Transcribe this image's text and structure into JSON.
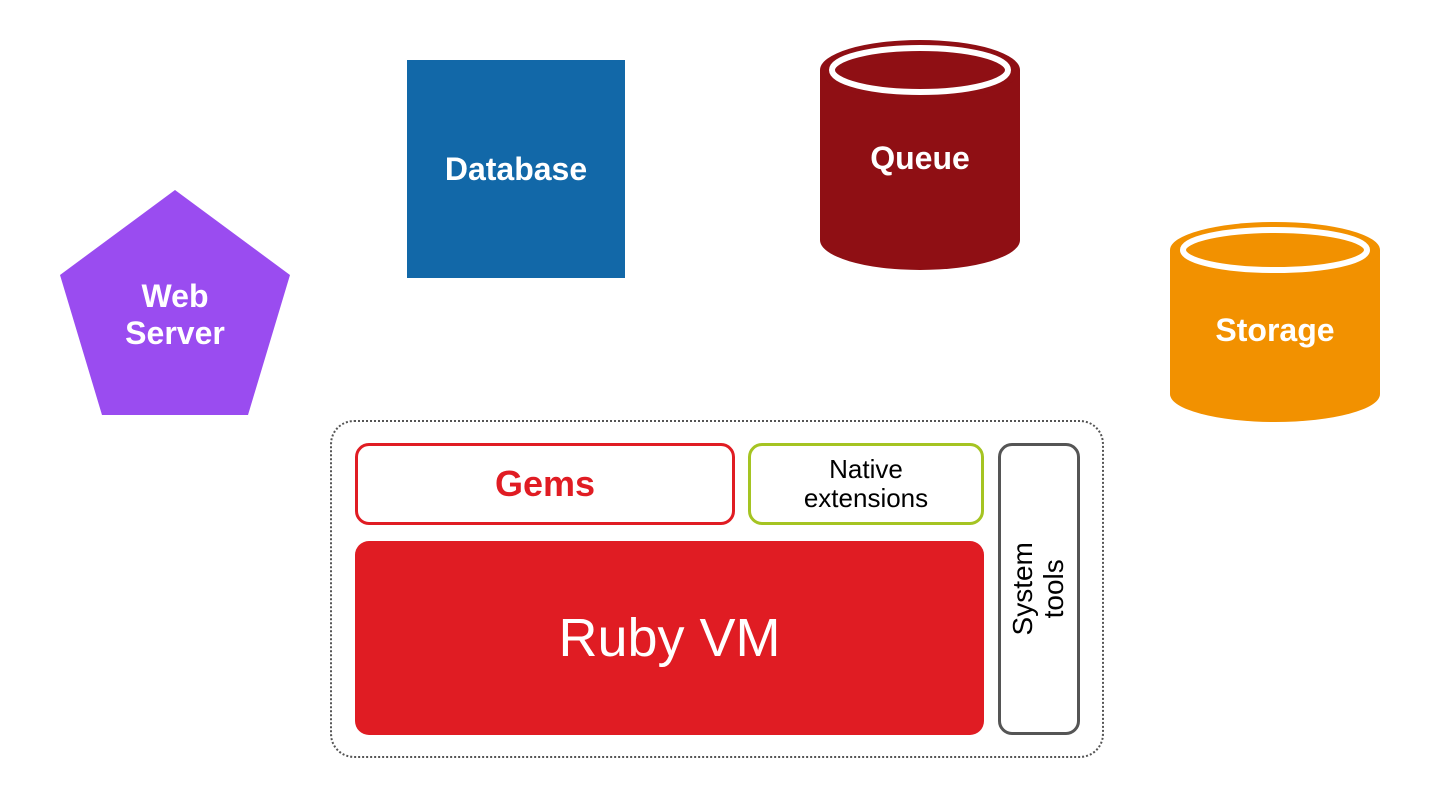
{
  "webServer": {
    "label": "Web\nServer",
    "color": "#9a4cf0"
  },
  "database": {
    "label": "Database",
    "color": "#1268a8"
  },
  "queue": {
    "label": "Queue",
    "color": "#8f0f14"
  },
  "storage": {
    "label": "Storage",
    "color": "#f29100"
  },
  "container": {
    "gems": {
      "label": "Gems",
      "border": "#e01c23"
    },
    "native": {
      "label": "Native\nextensions",
      "border": "#a5c422"
    },
    "rubyvm": {
      "label": "Ruby VM",
      "fill": "#e01c23"
    },
    "system": {
      "label": "System\ntools",
      "border": "#555555"
    }
  }
}
